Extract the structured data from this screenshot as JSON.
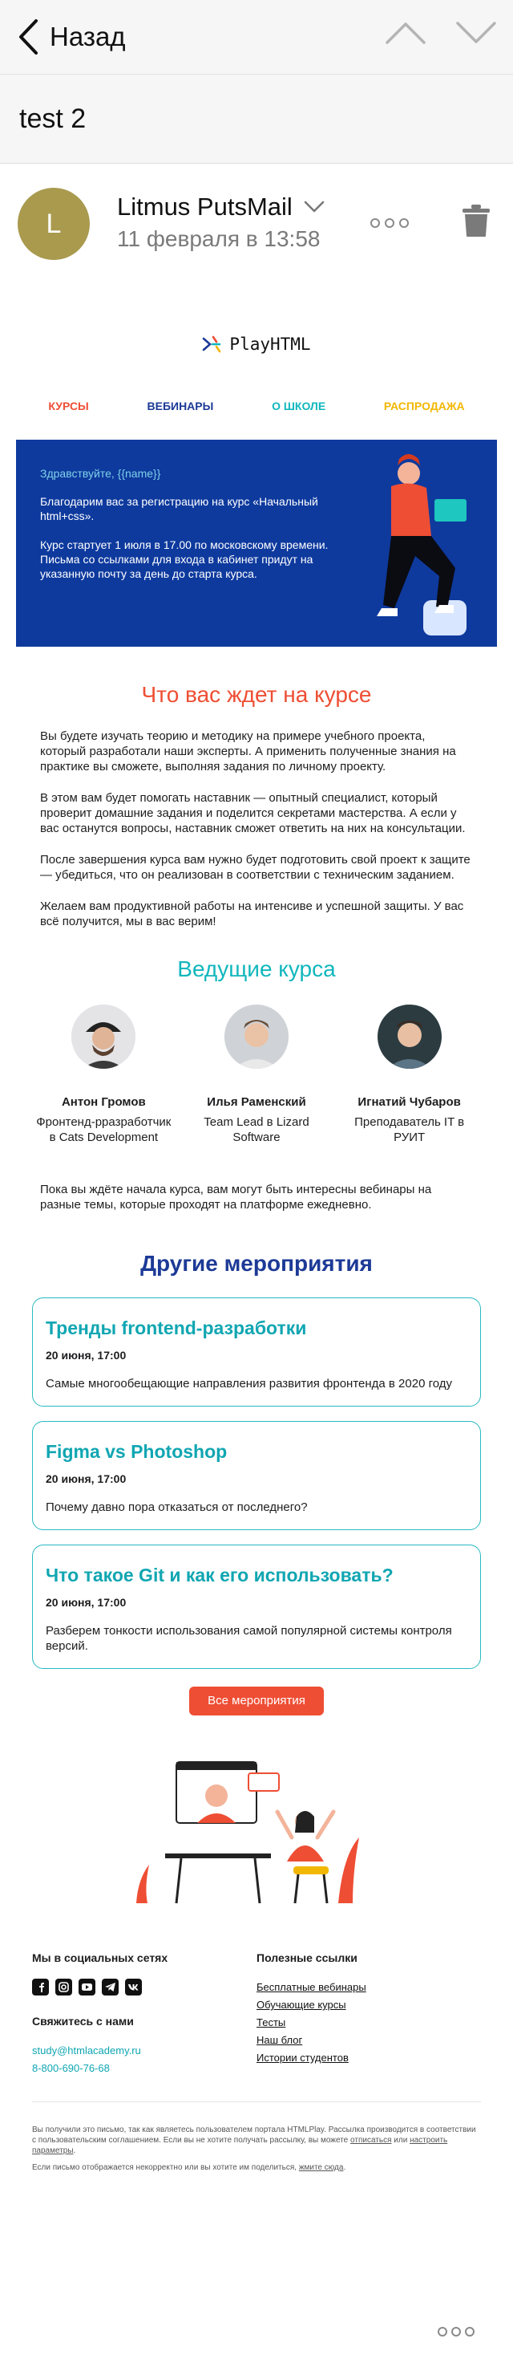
{
  "nav": {
    "back_label": "Назад",
    "icons": [
      "chevron-left-icon",
      "chevron-up-icon",
      "chevron-down-icon"
    ]
  },
  "subject": "test 2",
  "sender": {
    "avatar_letter": "L",
    "name": "Litmus PutsMail",
    "date": "11 февраля в 13:58",
    "avatar_color": "#a99a4e"
  },
  "email": {
    "logo_text": "PlayHTML",
    "menu": [
      {
        "label": "КУРСЫ",
        "color": "#ee4e34"
      },
      {
        "label": "ВЕБИНАРЫ",
        "color": "#1c3a96"
      },
      {
        "label": "О ШКОЛЕ",
        "color": "#10b7bd"
      },
      {
        "label": "РАСПРОДАЖА",
        "color": "#f2b705"
      }
    ],
    "hero": {
      "greeting": "Здравствуйте, {{name}}",
      "p1": "Благодарим вас за регистрацию на курс «Начальный html+css».",
      "p2": "Курс стартует 1 июля в 17.00 по московскому времени. Письма со ссылками для входа в кабинет придут на указанную почту за день до старта курса.",
      "bg_color": "#0e3a9e"
    },
    "course_title": "Что вас ждет на курсе",
    "course_paragraphs": [
      "Вы будете изучать теорию и методику на примере учебного проекта, который разработали наши эксперты. А применить полученные знания на практике вы сможете, выполняя задания по личному проекту.",
      "В этом вам будет помогать наставник — опытный специалист, который проверит домашние задания и поделится секретами мастерства. А если у вас останутся вопросы, наставник сможет ответить на них на консультации.",
      "После завершения курса вам нужно будет подготовить свой проект к защите — убедиться, что он реализован в соответствии с техническим заданием.",
      "Желаем вам продуктивной работы на интенсиве и успешной защиты. У вас всё получится, мы в вас верим!"
    ],
    "teachers_title": "Ведущие курса",
    "teachers": [
      {
        "name": "Антон Громов",
        "role": "Фронтенд-рразработчик в Cats Development"
      },
      {
        "name": "Илья Раменский",
        "role": "Team Lead в Lizard Software"
      },
      {
        "name": "Игнатий Чубаров",
        "role": "Преподаватель IT в РУИТ"
      }
    ],
    "webinar_note": "Пока вы ждёте начала курса, вам могут быть интересны вебинары на разные темы, которые проходят на платформе ежедневно.",
    "events_title": "Другие мероприятия",
    "events": [
      {
        "title": "Тренды frontend-разработки",
        "date": "20 июня, 17:00",
        "desc": "Самые многообещающие направления развития фронтенда в 2020 году"
      },
      {
        "title": "Figma vs Photoshop",
        "date": "20 июня, 17:00",
        "desc": "Почему давно пора отказаться от последнего?"
      },
      {
        "title": "Что такое Git и как его использовать?",
        "date": "20 июня, 17:00",
        "desc": "Разберем тонкости использования самой популярной системы контроля версий."
      }
    ],
    "all_events_button": "Все мероприятия",
    "footer": {
      "social_title": "Мы в социальных сетях",
      "social_icons": [
        "facebook-icon",
        "instagram-icon",
        "youtube-icon",
        "telegram-icon",
        "vk-icon"
      ],
      "contact_title": "Свяжитесь с нами",
      "email": "study@htmlacademy.ru",
      "phone": "8-800-690-76-68",
      "links_title": "Полезные ссылки",
      "links": [
        "Бесплатные вебинары",
        "Обучающие курсы",
        "Тесты",
        "Наш блог",
        "Истории студентов"
      ]
    },
    "legal": {
      "p1_start": "Вы получили это письмо, так как являетесь пользователем портала HTMLPlay. Рассылка производится в соответствии с пользовательским соглашением. Если вы не хотите получать рассылку, вы можете ",
      "unsubscribe": "отписаться",
      "p1_mid": " или ",
      "settings": "настроить параметры",
      "p1_end": ".",
      "p2_start": "Если письмо отображается некорректно или вы хотите им поделиться, ",
      "web_version": "жмите сюда",
      "p2_end": "."
    }
  }
}
